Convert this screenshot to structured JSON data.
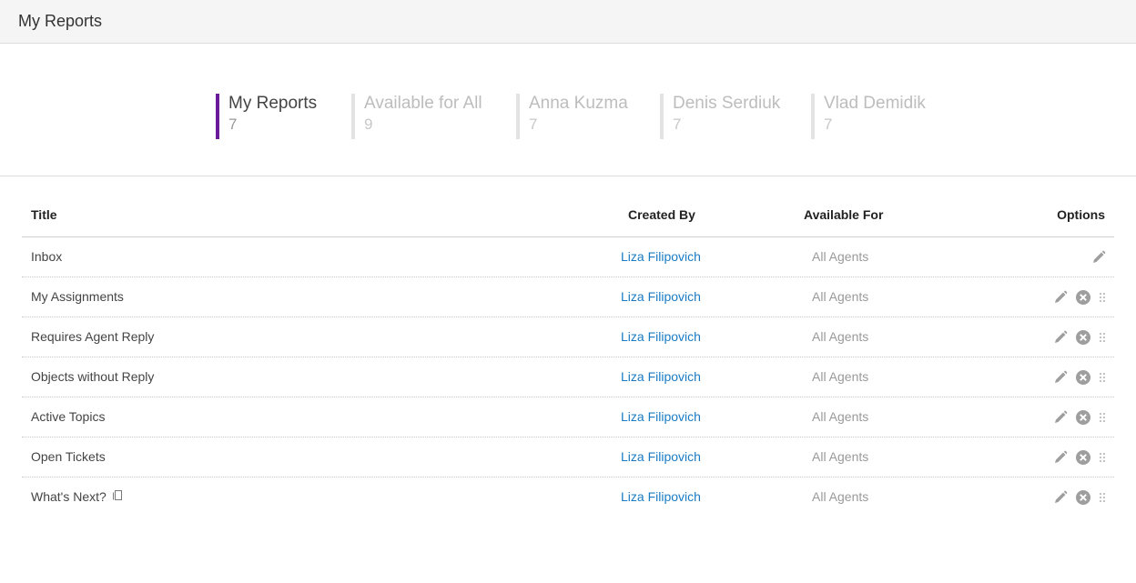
{
  "header": {
    "title": "My Reports"
  },
  "tabs": [
    {
      "label": "My Reports",
      "count": "7"
    },
    {
      "label": "Available for All",
      "count": "9"
    },
    {
      "label": "Anna Kuzma",
      "count": "7"
    },
    {
      "label": "Denis Serdiuk",
      "count": "7"
    },
    {
      "label": "Vlad Demidik",
      "count": "7"
    }
  ],
  "table": {
    "columns": {
      "title": "Title",
      "created_by": "Created By",
      "available_for": "Available For",
      "options": "Options"
    },
    "rows": [
      {
        "title": "Inbox",
        "created_by": "Liza Filipovich",
        "available_for": "All Agents"
      },
      {
        "title": "My Assignments",
        "created_by": "Liza Filipovich",
        "available_for": "All Agents"
      },
      {
        "title": "Requires Agent Reply",
        "created_by": "Liza Filipovich",
        "available_for": "All Agents"
      },
      {
        "title": "Objects without Reply",
        "created_by": "Liza Filipovich",
        "available_for": "All Agents"
      },
      {
        "title": "Active Topics",
        "created_by": "Liza Filipovich",
        "available_for": "All Agents"
      },
      {
        "title": "Open Tickets",
        "created_by": "Liza Filipovich",
        "available_for": "All Agents"
      },
      {
        "title": "What's Next?",
        "created_by": "Liza Filipovich",
        "available_for": "All Agents"
      }
    ]
  },
  "icons": {
    "edit": "pencil-icon",
    "delete": "close-circle-icon",
    "reorder": "drag-handle-icon",
    "copy": "copy-icon"
  },
  "colors": {
    "active_tab_accent": "#6a1b9a",
    "link": "#1a7bc4",
    "icon": "#9e9e9e"
  }
}
